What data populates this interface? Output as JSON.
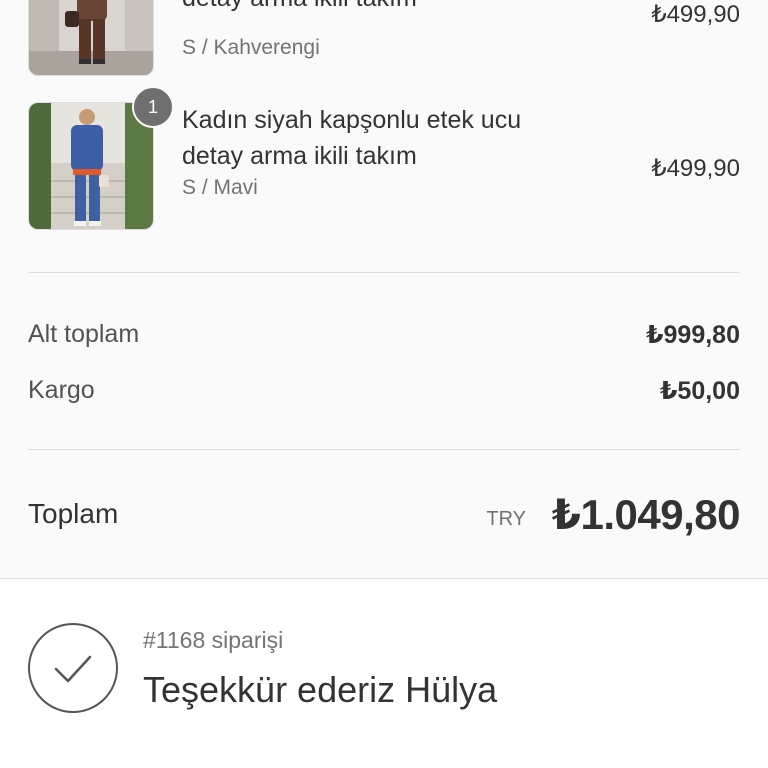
{
  "items": [
    {
      "title_line2": "detay arma ikili takım",
      "variant": "S / Kahverengi",
      "price": "₺499,90",
      "image_icon": "product-photo-brown-outfit"
    },
    {
      "quantity": "1",
      "title_line1": "Kadın siyah kapşonlu etek ucu",
      "title_line2": "detay arma ikili takım",
      "variant": "S / Mavi",
      "price": "₺499,90",
      "image_icon": "product-photo-blue-outfit"
    }
  ],
  "totals": {
    "subtotal_label": "Alt toplam",
    "subtotal_value": "₺999,80",
    "shipping_label": "Kargo",
    "shipping_value": "₺50,00",
    "total_label": "Toplam",
    "currency": "TRY",
    "total_value": "₺1.049,80"
  },
  "confirmation": {
    "order_number": "#1168 siparişi",
    "thank_you": "Teşekkür ederiz Hülya",
    "icon": "checkmark-circle-icon"
  },
  "colors": {
    "summary_background": "#fafafa",
    "text": "#333333",
    "muted_text": "#737373",
    "badge": "#6f6f6f"
  }
}
